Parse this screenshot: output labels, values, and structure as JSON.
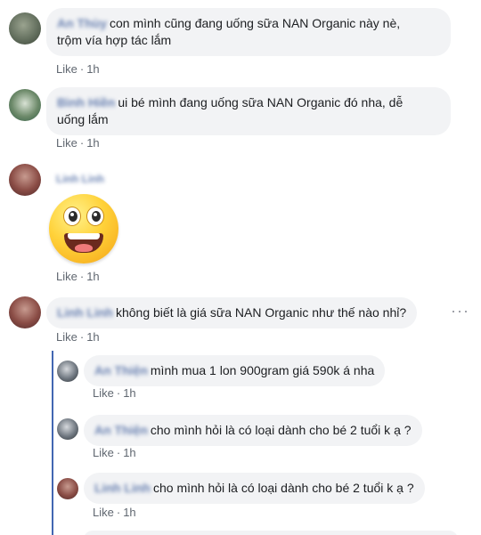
{
  "comments": [
    {
      "name": "An Thùy",
      "text_line1": "con mình cũng đang uống sữa NAN Organic này nè,",
      "text_line2": "trộm vía hợp tác lắm",
      "like": "Like",
      "time": "1h"
    },
    {
      "name": "Bình Hiền",
      "text_line1": "ui bé mình đang uống sữa NAN Organic đó nha, dễ",
      "text_line2": "uống lắm",
      "like": "Like",
      "time": "1h"
    },
    {
      "name": "Linh Linh",
      "like": "Like",
      "time": "1h"
    },
    {
      "name": "Linh Linh",
      "text": "không biết là giá sữa NAN Organic như thế nào nhỉ?",
      "like": "Like",
      "time": "1h",
      "more": "···"
    }
  ],
  "replies": [
    {
      "name": "An Thiện",
      "text": "mình mua 1 lon 900gram giá 590k á nha",
      "like": "Like",
      "time": "1h"
    },
    {
      "name": "An Thiện",
      "text": "cho mình hỏi là có loại dành cho bé 2 tuổi k ạ ?",
      "like": "Like",
      "time": "1h"
    },
    {
      "name": "Linh Linh",
      "text": "cho mình hỏi là có loại dành cho bé 2 tuổi k ạ ?",
      "like": "Like",
      "time": "1h"
    }
  ],
  "colors": {
    "bubble": "#f2f3f5",
    "name": "#385898",
    "meta": "#606770",
    "thread": "#4267b2"
  },
  "icons": {
    "sticker": "grinning-face-sticker"
  }
}
